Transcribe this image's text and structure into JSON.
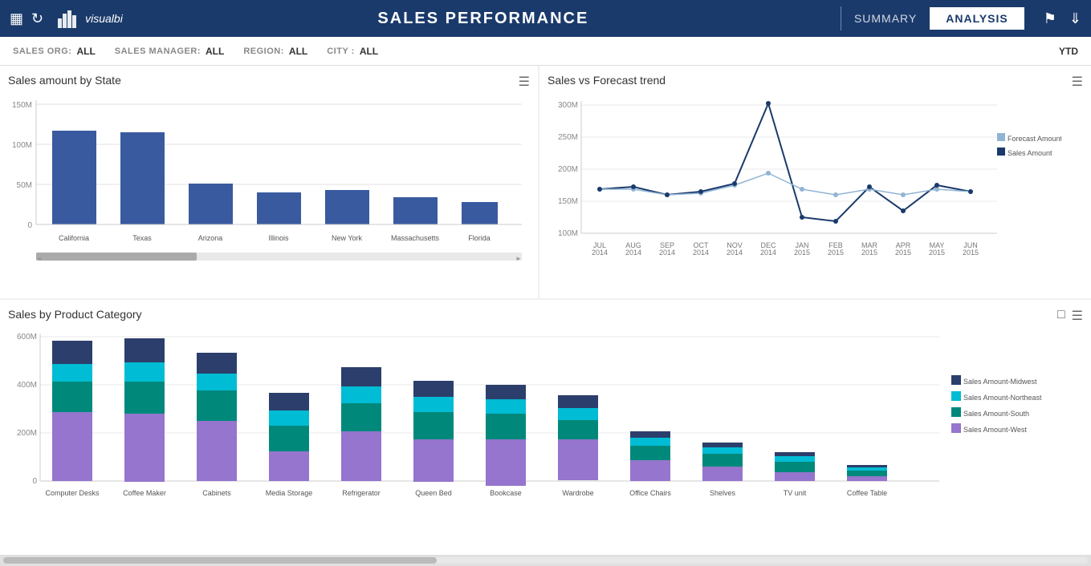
{
  "header": {
    "title": "SALES PERFORMANCE",
    "summary_label": "SUMMARY",
    "analysis_label": "ANALYSIS",
    "logo_text": "visualbi"
  },
  "filters": {
    "sales_org_label": "SALES ORG:",
    "sales_org_value": "ALL",
    "sales_manager_label": "SALES MANAGER:",
    "sales_manager_value": "ALL",
    "region_label": "REGION:",
    "region_value": "ALL",
    "city_label": "CITY :",
    "city_value": "ALL",
    "period": "YTD"
  },
  "panel_left": {
    "title": "Sales amount by State"
  },
  "panel_right": {
    "title": "Sales vs Forecast trend"
  },
  "panel_bottom": {
    "title": "Sales by Product Category"
  },
  "state_bars": [
    {
      "label": "California",
      "value": 110,
      "height_pct": 73
    },
    {
      "label": "Texas",
      "value": 108,
      "height_pct": 72
    },
    {
      "label": "Arizona",
      "value": 48,
      "height_pct": 32
    },
    {
      "label": "Illinois",
      "value": 38,
      "height_pct": 25
    },
    {
      "label": "New York",
      "value": 40,
      "height_pct": 27
    },
    {
      "label": "Massachusetts",
      "value": 32,
      "height_pct": 21
    },
    {
      "label": "Florida",
      "value": 26,
      "height_pct": 17
    }
  ],
  "state_y_axis": [
    "150M",
    "100M",
    "50M",
    "0"
  ],
  "trend_legend": {
    "forecast": "Forecast Amount",
    "sales": "Sales Amount"
  },
  "trend_x_labels": [
    "JUL\n2014",
    "AUG\n2014",
    "SEP\n2014",
    "OCT\n2014",
    "NOV\n2014",
    "DEC\n2014",
    "JAN\n2015",
    "FEB\n2015",
    "MAR\n2015",
    "APR\n2015",
    "MAY\n2015",
    "JUN\n2015"
  ],
  "trend_y_axis": [
    "300M",
    "250M",
    "200M",
    "150M",
    "100M"
  ],
  "product_categories": [
    {
      "label": "Computer Desks",
      "midwest": 90,
      "northeast": 70,
      "south": 120,
      "west": 270
    },
    {
      "label": "Coffee Maker",
      "midwest": 95,
      "northeast": 75,
      "south": 125,
      "west": 265
    },
    {
      "label": "Cabinets",
      "midwest": 80,
      "northeast": 65,
      "south": 120,
      "west": 235
    },
    {
      "label": "Media Storage",
      "midwest": 70,
      "northeast": 60,
      "south": 100,
      "west": 115
    },
    {
      "label": "Refrigerator",
      "midwest": 75,
      "northeast": 65,
      "south": 110,
      "west": 195
    },
    {
      "label": "Queen Bed",
      "midwest": 60,
      "northeast": 60,
      "south": 105,
      "west": 165
    },
    {
      "label": "Bookcase",
      "midwest": 55,
      "northeast": 55,
      "south": 100,
      "west": 180
    },
    {
      "label": "Wardrobe",
      "midwest": 50,
      "northeast": 45,
      "south": 75,
      "west": 160
    },
    {
      "label": "Office Chairs",
      "midwest": 25,
      "northeast": 30,
      "south": 55,
      "west": 80
    },
    {
      "label": "Shelves",
      "midwest": 20,
      "northeast": 25,
      "south": 50,
      "west": 55
    },
    {
      "label": "TV unit",
      "midwest": 18,
      "northeast": 20,
      "south": 40,
      "west": 35
    },
    {
      "label": "Coffee Table",
      "midwest": 10,
      "northeast": 12,
      "south": 20,
      "west": 20
    }
  ],
  "product_y_axis": [
    "600M",
    "400M",
    "200M",
    "0"
  ],
  "legend": {
    "midwest": "Sales Amount-Midwest",
    "northeast": "Sales Amount-Northeast",
    "south": "Sales Amount-South",
    "west": "Sales Amount-West"
  },
  "colors": {
    "bar_blue": "#3a5a9f",
    "midwest": "#2c3e6b",
    "northeast": "#00bcd4",
    "south": "#00897b",
    "west": "#9575cd",
    "header_bg": "#1a3a6b"
  }
}
